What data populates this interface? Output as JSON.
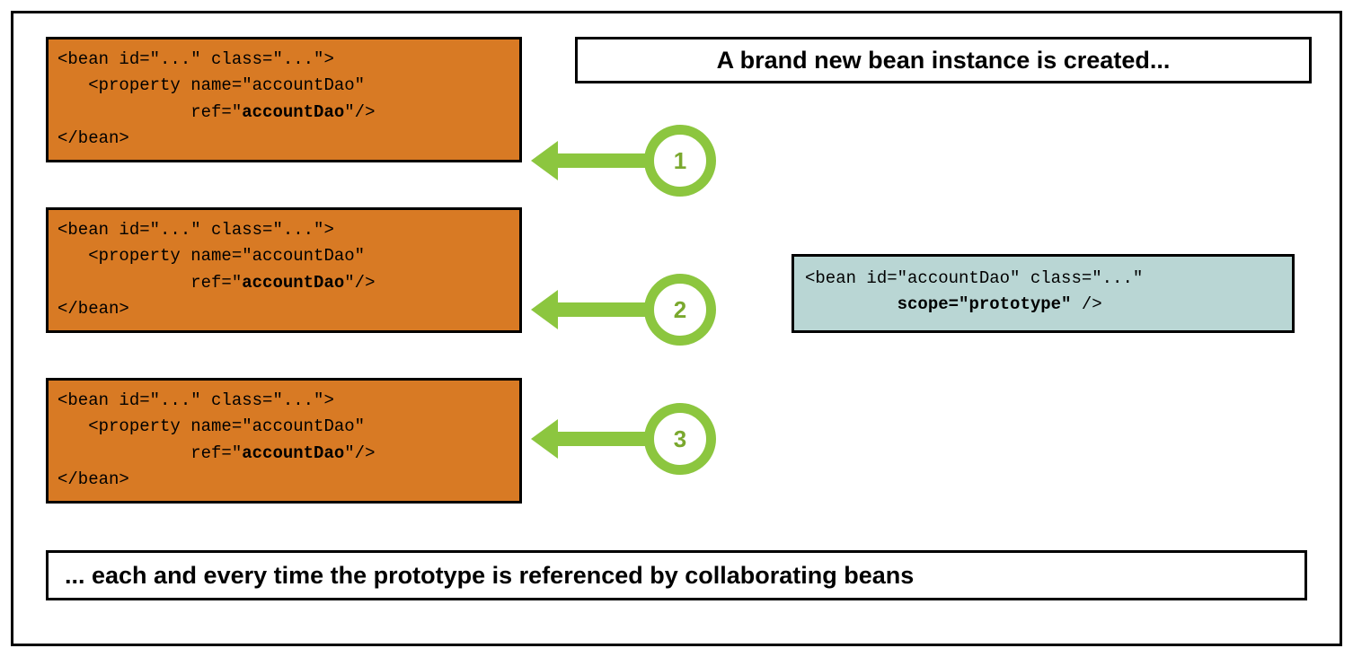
{
  "title_top": "A brand new bean instance is created...",
  "title_bottom": "... each and every time the prototype is referenced by collaborating beans",
  "bean_block": {
    "line1": "<bean id=\"...\" class=\"...\">",
    "line2_pre": "   <property name=\"accountDao\"",
    "line3_pre": "             ref=\"",
    "line3_bold": "accountDao",
    "line3_post": "\"/>",
    "line4": "</bean>"
  },
  "proto_block": {
    "line1": "<bean id=\"accountDao\" class=\"...\"",
    "line2_pre": "         ",
    "line2_bold": "scope=\"prototype\"",
    "line2_post": " />"
  },
  "circles": {
    "c1": "1",
    "c2": "2",
    "c3": "3"
  }
}
